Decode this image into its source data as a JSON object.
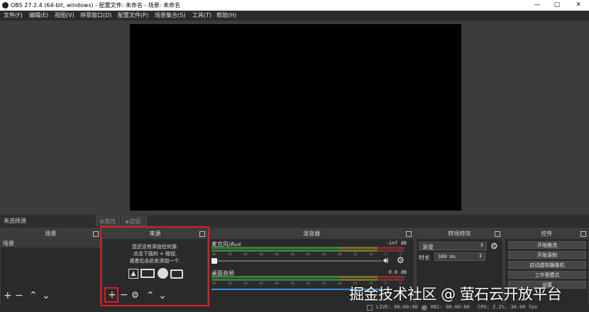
{
  "window": {
    "title": "OBS 27.2.4 (64-bit, windows) - 配置文件: 未命名 - 场景: 未命名",
    "controls": {
      "minimize": "—",
      "maximize": "▢",
      "close": "✕"
    }
  },
  "menu": [
    "文件(F)",
    "编辑(E)",
    "视图(V)",
    "停靠窗口(D)",
    "配置文件(P)",
    "场景集合(S)",
    "工具(T)",
    "帮助(H)"
  ],
  "source_toolbar": {
    "no_source": "未选择源",
    "properties": "属性",
    "filters": "滤镜"
  },
  "docks": {
    "scenes": {
      "title": "场景",
      "items": [
        "场景"
      ]
    },
    "sources": {
      "title": "来源",
      "empty_lines": [
        "您还没有添加任何源.",
        "点击下面的 + 按钮,",
        "或者右击此处添加一个."
      ]
    },
    "mixer": {
      "title": "混音器",
      "channels": [
        {
          "name": "麦克风/Aux",
          "level": "-inf dB",
          "volume": 0.0
        },
        {
          "name": "桌面音频",
          "level": "0.0 dB",
          "volume": 1.0
        }
      ],
      "ticks": [
        "-60",
        "-55",
        "-50",
        "-45",
        "-40",
        "-35",
        "-30",
        "-25",
        "-20",
        "-15",
        "-10",
        "-5",
        "0"
      ]
    },
    "transitions": {
      "title": "转场特效",
      "type": "渐变",
      "duration_label": "时长",
      "duration_value": "300 ms"
    },
    "controls": {
      "title": "控件",
      "buttons": [
        "开始推流",
        "开始录制",
        "启动虚拟摄像机",
        "工作室模式",
        "设置"
      ]
    }
  },
  "status": {
    "live": "LIVE: 00:00:00",
    "rec": "REC: 00:00:00",
    "cpu": "CPU: 2.2%, 30.00 fps"
  },
  "watermark": "掘金技术社区 @ 萤石云开放平台",
  "colors": {
    "highlight": "#e01e1e",
    "meter_green": "#4caf50",
    "meter_yellow": "#c8b030",
    "meter_red": "#b03030",
    "slider_blue": "#3b8de0"
  }
}
